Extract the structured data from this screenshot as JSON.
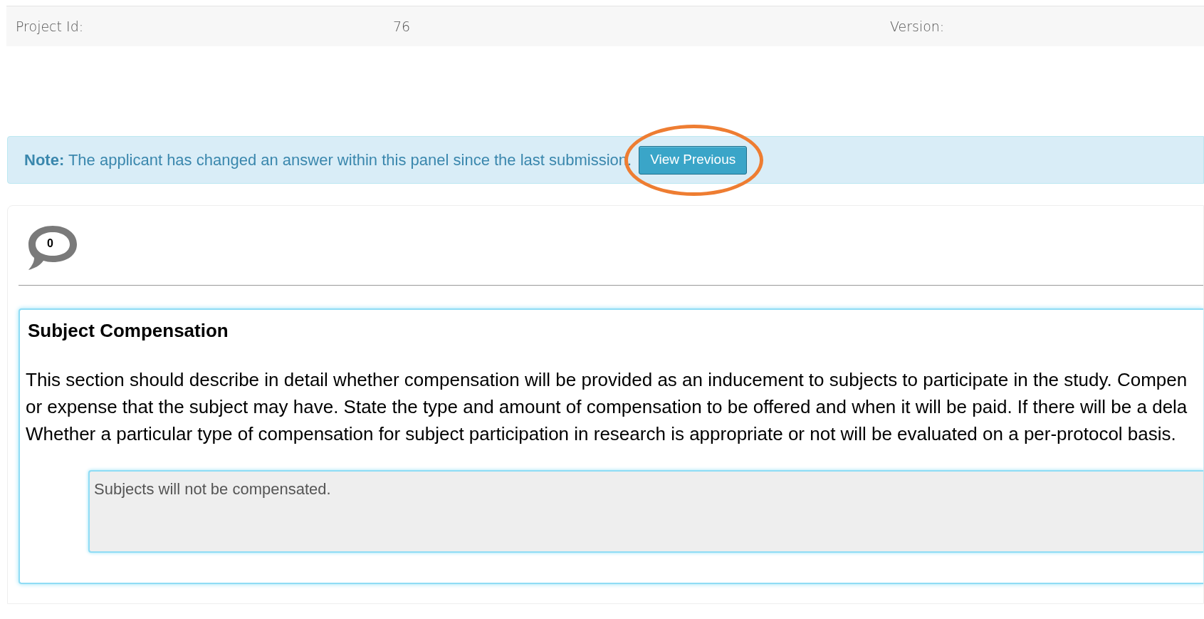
{
  "project": {
    "id_label": "Project Id:",
    "id_value": "76",
    "version_label": "Version:"
  },
  "note": {
    "label": "Note:",
    "text": "The applicant has changed an answer within this panel since the last submission.",
    "button": "View Previous",
    "highlighted": true
  },
  "comments": {
    "count": "0"
  },
  "section": {
    "title": "Subject Compensation",
    "lines": [
      "This section should describe in detail whether compensation will be provided as an inducement to subjects to participate in the study. Compen",
      "or expense that the subject may have. State the type and amount of compensation to be offered and when it will be paid. If there will be a dela",
      "Whether a particular type of compensation for subject participation in research is appropriate or not will be evaluated on a per-protocol basis."
    ],
    "answer": "Subjects will not be compensated."
  }
}
